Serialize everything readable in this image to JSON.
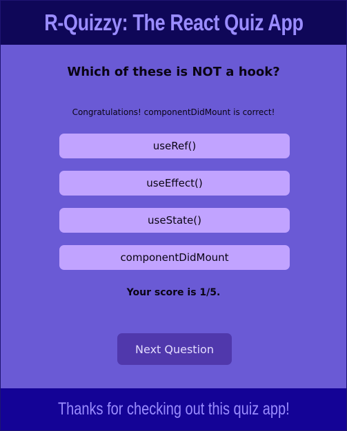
{
  "header": {
    "title": "R-Quizzy: The React Quiz App"
  },
  "quiz": {
    "question": "Which of these is NOT a hook?",
    "feedback": "Congratulations! componentDidMount is correct!",
    "answers": [
      {
        "label": "useRef()"
      },
      {
        "label": "useEffect()"
      },
      {
        "label": "useState()"
      },
      {
        "label": "componentDidMount"
      }
    ],
    "score_text": "Your score is 1/5.",
    "next_label": "Next Question"
  },
  "footer": {
    "text": "Thanks for checking out this quiz app!"
  },
  "colors": {
    "header_bg": "#0f0758",
    "title_text": "#9a8cff",
    "main_bg": "#6a5ad5",
    "answer_bg": "#c1a3ff",
    "next_bg": "#5038ac",
    "footer_bg": "#140396"
  }
}
